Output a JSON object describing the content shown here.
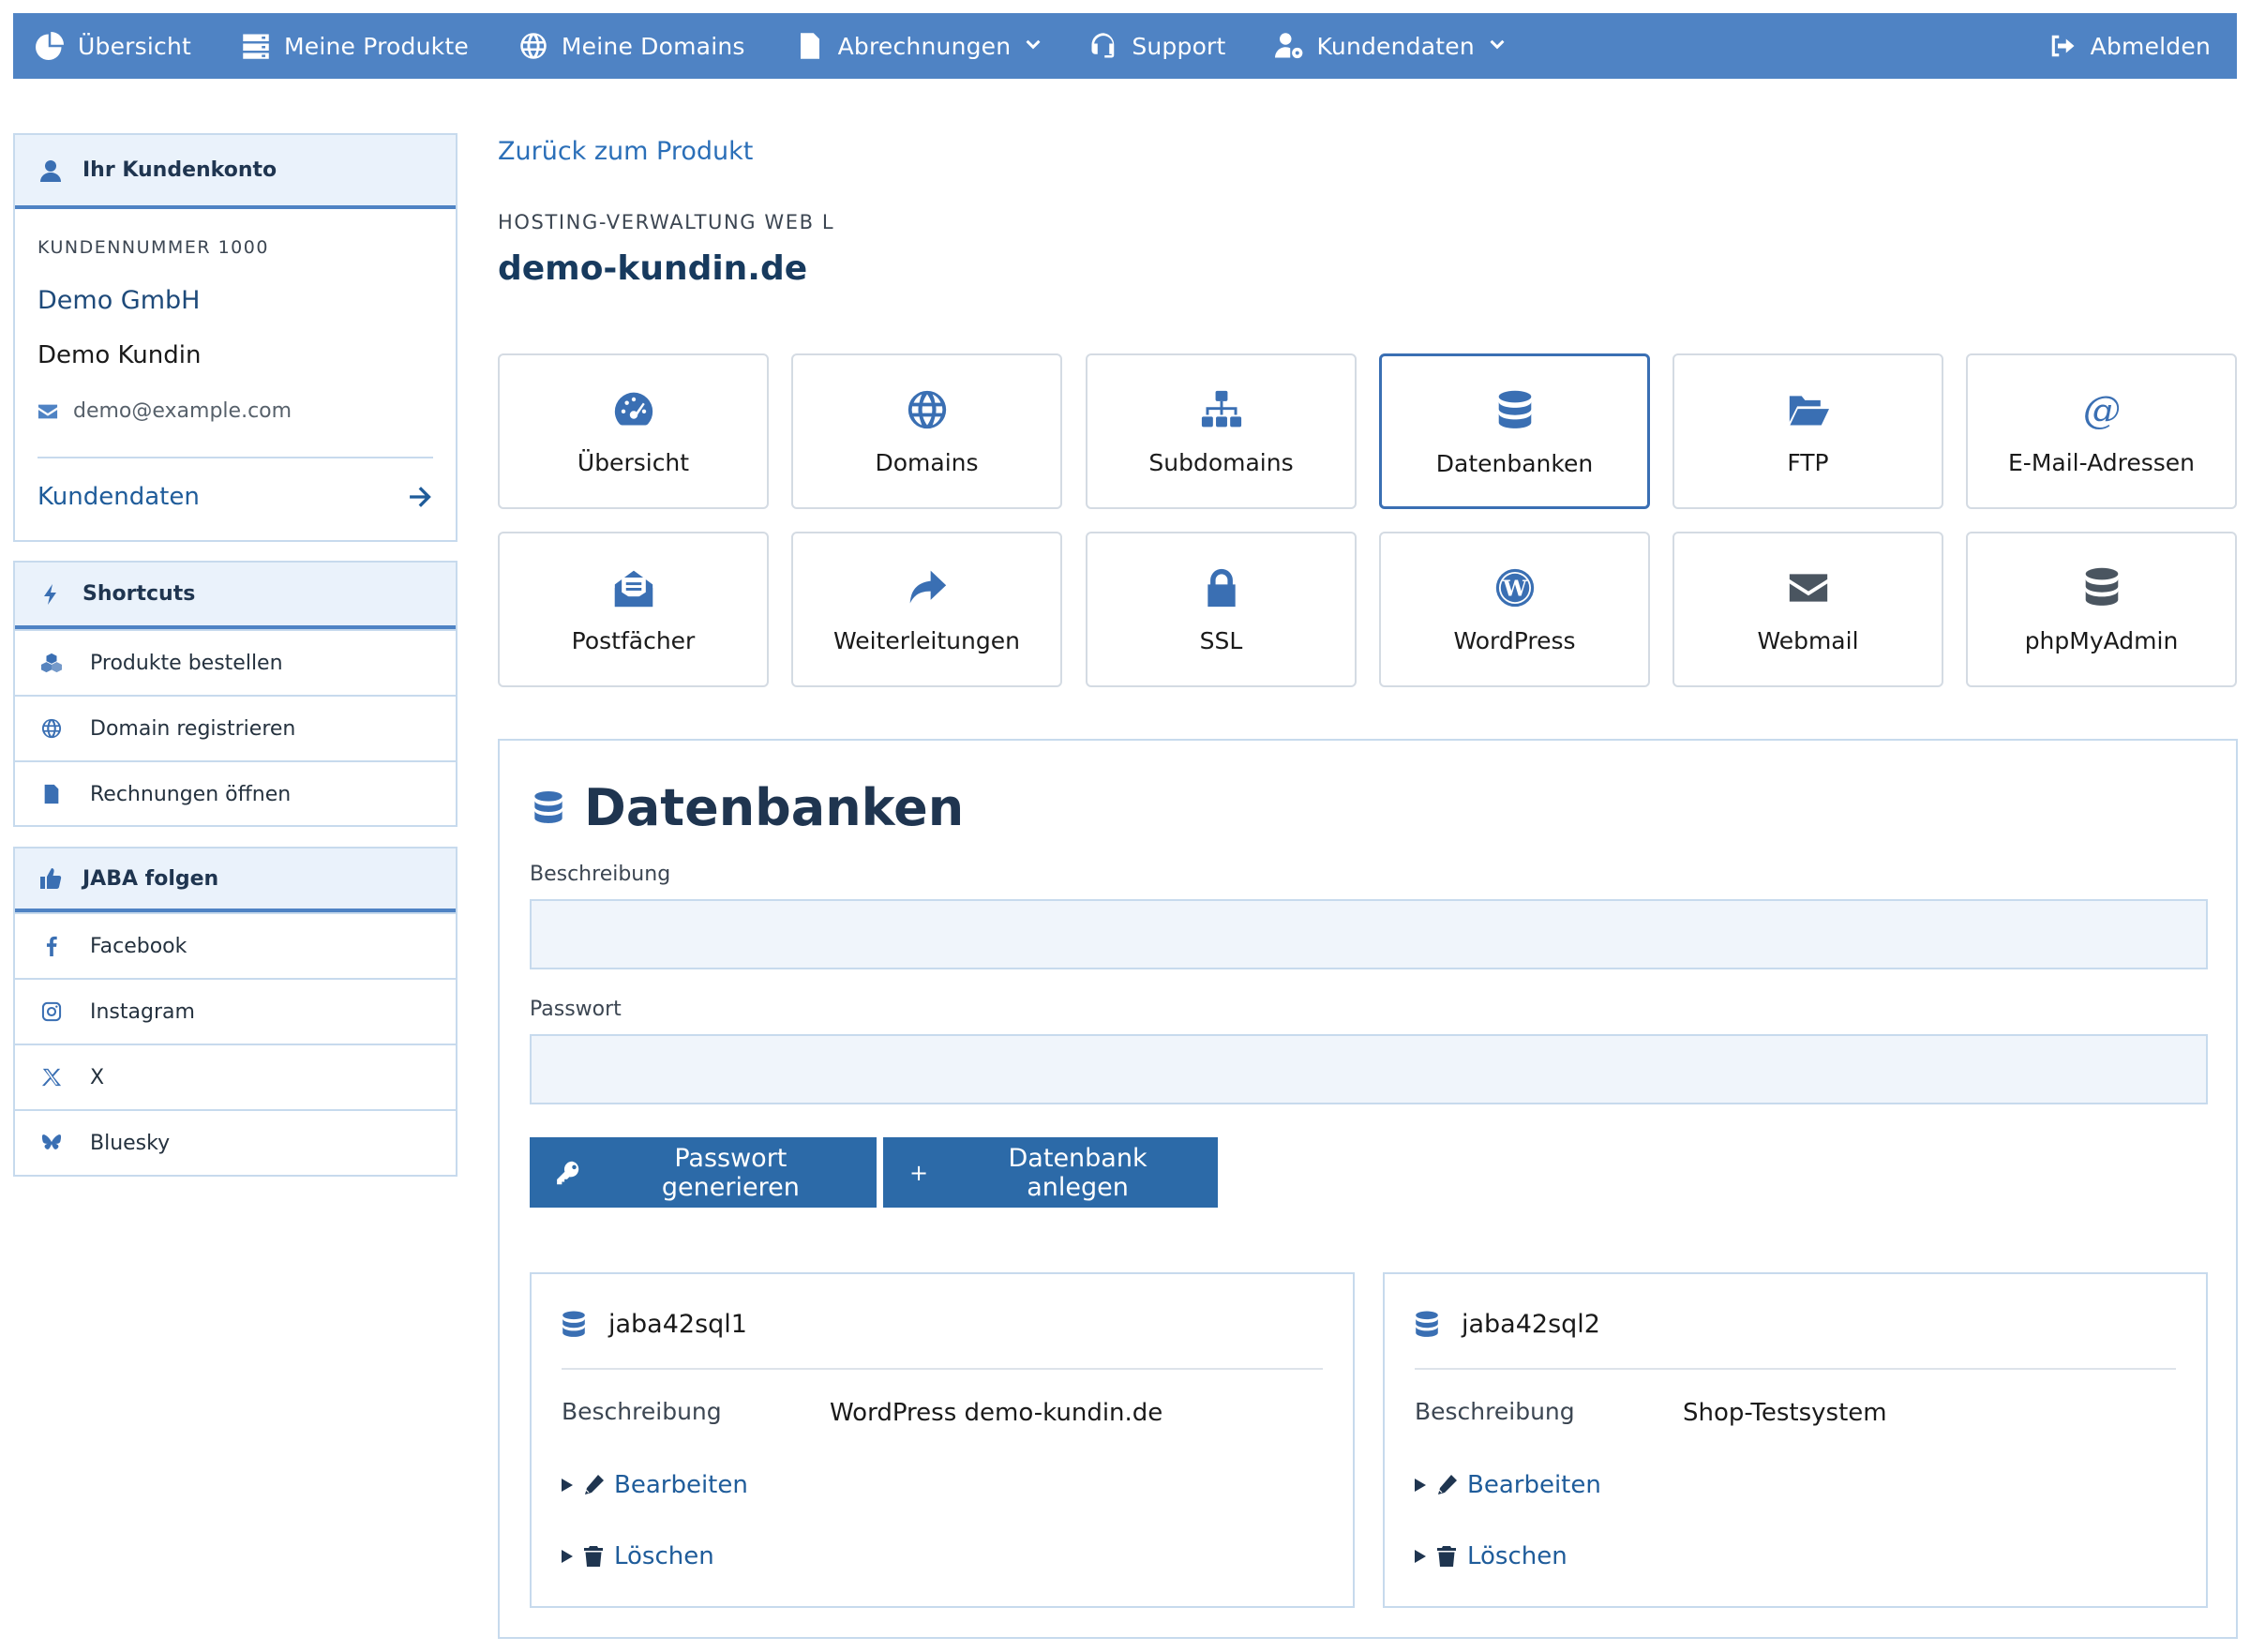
{
  "nav": {
    "items": [
      {
        "label": "Übersicht",
        "icon": "chart-pie-icon"
      },
      {
        "label": "Meine Produkte",
        "icon": "server-icon"
      },
      {
        "label": "Meine Domains",
        "icon": "globe-icon"
      },
      {
        "label": "Abrechnungen",
        "icon": "document-icon",
        "dropdown": true
      },
      {
        "label": "Support",
        "icon": "headset-icon"
      },
      {
        "label": "Kundendaten",
        "icon": "user-cog-icon",
        "dropdown": true
      }
    ],
    "logout": "Abmelden"
  },
  "sidebar": {
    "account": {
      "heading": "Ihr Kundenkonto",
      "customer_number": "KUNDENNUMMER 1000",
      "company": "Demo GmbH",
      "name": "Demo Kundin",
      "email": "demo@example.com",
      "link": "Kundendaten"
    },
    "shortcuts": {
      "heading": "Shortcuts",
      "items": [
        "Produkte bestellen",
        "Domain registrieren",
        "Rechnungen öffnen"
      ]
    },
    "social": {
      "heading": "JABA folgen",
      "items": [
        "Facebook",
        "Instagram",
        "X",
        "Bluesky"
      ]
    }
  },
  "main": {
    "back_link": "Zurück zum Produkt",
    "kicker": "HOSTING-VERWALTUNG WEB L",
    "domain": "demo-kundin.de",
    "tiles": [
      {
        "label": "Übersicht",
        "icon": "gauge-icon"
      },
      {
        "label": "Domains",
        "icon": "globe-icon"
      },
      {
        "label": "Subdomains",
        "icon": "sitemap-icon"
      },
      {
        "label": "Datenbanken",
        "icon": "database-icon",
        "active": true
      },
      {
        "label": "FTP",
        "icon": "folder-open-icon"
      },
      {
        "label": "E-Mail-Adressen",
        "icon": "at-icon"
      },
      {
        "label": "Postfächer",
        "icon": "envelope-open-icon"
      },
      {
        "label": "Weiterleitungen",
        "icon": "share-arrow-icon"
      },
      {
        "label": "SSL",
        "icon": "lock-icon"
      },
      {
        "label": "WordPress",
        "icon": "wordpress-icon"
      },
      {
        "label": "Webmail",
        "icon": "envelope-icon"
      },
      {
        "label": "phpMyAdmin",
        "icon": "database-icon"
      }
    ],
    "panel": {
      "title": "Datenbanken",
      "description_label": "Beschreibung",
      "description_value": "",
      "password_label": "Passwort",
      "password_value": "",
      "btn_generate": "Passwort generieren",
      "btn_create_plus": "+",
      "btn_create": "Datenbank anlegen",
      "databases": [
        {
          "name": "jaba42sql1",
          "desc_label": "Beschreibung",
          "desc": "WordPress demo-kundin.de",
          "edit": "Bearbeiten",
          "delete": "Löschen"
        },
        {
          "name": "jaba42sql2",
          "desc_label": "Beschreibung",
          "desc": "Shop-Testsystem",
          "edit": "Bearbeiten",
          "delete": "Löschen"
        }
      ]
    }
  },
  "colors": {
    "nav_bg": "#4f83c4",
    "accent": "#3a6fb3",
    "button": "#2c6aa8",
    "link": "#2b6fb8",
    "border": "#c7daed",
    "head_bg": "#eaf2fb"
  }
}
